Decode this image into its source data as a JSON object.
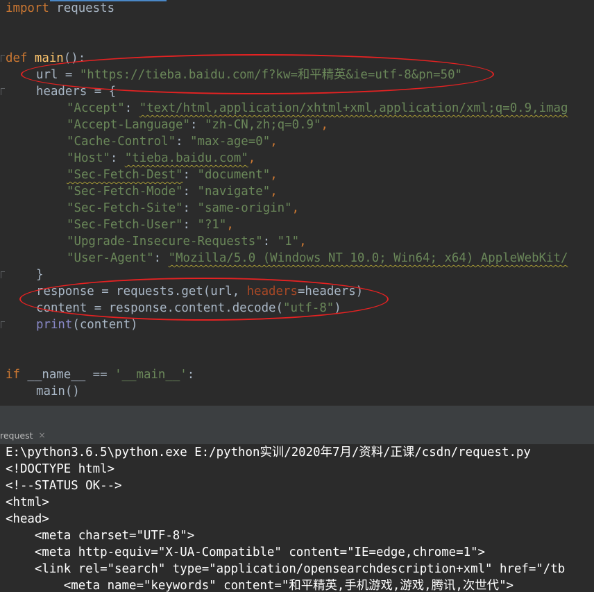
{
  "editor": {
    "lines": {
      "import_kw": "import",
      "import_mod": " requests",
      "def_kw": "def",
      "def_name": " main",
      "def_rest": "():",
      "url_var": "url = ",
      "url_val": "\"https://tieba.baidu.com/f?kw=和平精英&ie=utf-8&pn=50\"",
      "headers_open": "headers = {",
      "h_accept_key": "\"Accept\"",
      "h_accept_val": "\"text/html,application/xhtml+xml,application/xml;q=0.9,imag",
      "h_lang_key": "\"Accept-Language\"",
      "h_lang_val": "\"zh-CN,zh;q=0.9\"",
      "h_cache_key": "\"Cache-Control\"",
      "h_cache_val": "\"max-age=0\"",
      "h_host_key": "\"Host\"",
      "h_host_val": "\"tieba.baidu.com\"",
      "h_dest_key": "\"Sec-Fetch-Dest\"",
      "h_dest_val": "\"document\"",
      "h_mode_key": "\"Sec-Fetch-Mode\"",
      "h_mode_val": "\"navigate\"",
      "h_site_key": "\"Sec-Fetch-Site\"",
      "h_site_val": "\"same-origin\"",
      "h_user_key": "\"Sec-Fetch-User\"",
      "h_user_val": "\"?1\"",
      "h_uir_key": "\"Upgrade-Insecure-Requests\"",
      "h_uir_val": "\"1\"",
      "h_ua_key": "\"User-Agent\"",
      "h_ua_val": "\"Mozilla/5.0 (Windows NT 10.0; Win64; x64) AppleWebKit/",
      "sep": ": ",
      "comma": ",",
      "close_brace": "}",
      "response_a": "response = requests.get(url, ",
      "response_param": "headers",
      "response_b": "=headers)",
      "content_a": "content = response.content.decode(",
      "content_str": "\"utf-8\"",
      "content_b": ")",
      "print_fn": "print",
      "print_rest": "(content)",
      "if_kw": "if",
      "if_a": " __name__ == ",
      "if_str": "'__main__'",
      "if_b": ":",
      "main_call": "main()"
    }
  },
  "run_panel": {
    "tab_label": "request",
    "tab_close": "×",
    "console_lines": [
      "E:\\python3.6.5\\python.exe E:/python实训/2020年7月/资料/正课/csdn/request.py",
      "<!DOCTYPE html>",
      "<!--STATUS OK-->",
      "<html>",
      "<head>",
      "    <meta charset=\"UTF-8\">",
      "    <meta http-equiv=\"X-UA-Compatible\" content=\"IE=edge,chrome=1\">",
      "    <link rel=\"search\" type=\"application/opensearchdescription+xml\" href=\"/tb",
      "        <meta name=\"keywords\" content=\"和平精英,手机游戏,游戏,腾讯,次世代\">"
    ]
  },
  "colors": {
    "background": "#2b2b2b",
    "keyword": "#cc7832",
    "string": "#6a8759",
    "function": "#ffc66d",
    "annotation": "#e52222"
  }
}
